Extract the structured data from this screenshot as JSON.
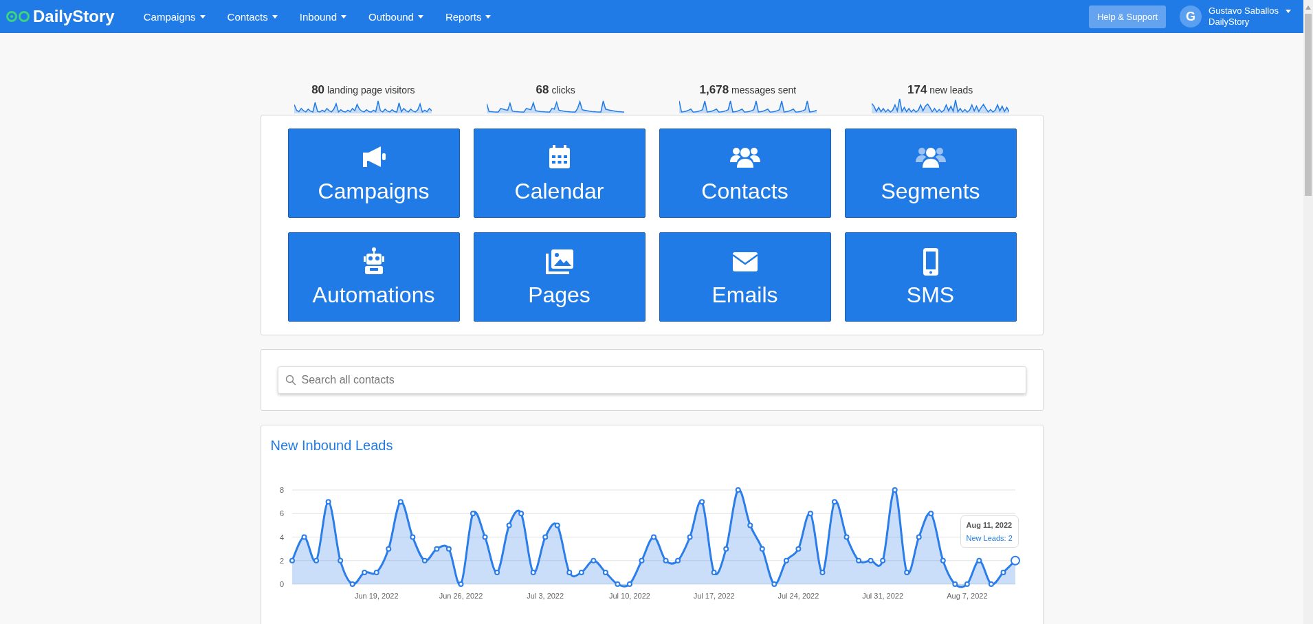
{
  "nav": {
    "logo": "DailyStory",
    "menu": [
      {
        "label": "Campaigns"
      },
      {
        "label": "Contacts"
      },
      {
        "label": "Inbound"
      },
      {
        "label": "Outbound"
      },
      {
        "label": "Reports"
      }
    ],
    "help_button": "Help & Support",
    "user": {
      "initial": "G",
      "name": "Gustavo Saballos",
      "org": "DailyStory"
    }
  },
  "stats": [
    {
      "value": "80",
      "label": "landing page visitors"
    },
    {
      "value": "68",
      "label": "clicks"
    },
    {
      "value": "1,678",
      "label": "messages sent"
    },
    {
      "value": "174",
      "label": "new leads"
    }
  ],
  "tiles": [
    {
      "label": "Campaigns",
      "kind": "megaphone"
    },
    {
      "label": "Calendar",
      "kind": "calendar"
    },
    {
      "label": "Contacts",
      "kind": "users"
    },
    {
      "label": "Segments",
      "kind": "group"
    },
    {
      "label": "Automations",
      "kind": "robot"
    },
    {
      "label": "Pages",
      "kind": "images"
    },
    {
      "label": "Emails",
      "kind": "envelope"
    },
    {
      "label": "SMS",
      "kind": "phone"
    }
  ],
  "search": {
    "placeholder": "Search all contacts"
  },
  "leads_panel": {
    "title": "New Inbound Leads",
    "tooltip": {
      "date": "Aug 11, 2022",
      "text": "New Leads: 2"
    },
    "chart_data": {
      "type": "area",
      "categories": [
        null,
        null,
        null,
        null,
        null,
        null,
        null,
        "Jun 19, 2022",
        null,
        null,
        null,
        null,
        null,
        null,
        "Jun 26, 2022",
        null,
        null,
        null,
        null,
        null,
        null,
        "Jul 3, 2022",
        null,
        null,
        null,
        null,
        null,
        null,
        "Jul 10, 2022",
        null,
        null,
        null,
        null,
        null,
        null,
        "Jul 17, 2022",
        null,
        null,
        null,
        null,
        null,
        null,
        "Jul 24, 2022",
        null,
        null,
        null,
        null,
        null,
        null,
        "Jul 31, 2022",
        null,
        null,
        null,
        null,
        null,
        null,
        "Aug 7, 2022",
        null,
        null,
        null,
        null
      ],
      "series": [
        {
          "color": "#2b7de9",
          "values": [
            2,
            4,
            2,
            7,
            2,
            0,
            1,
            1,
            3,
            7,
            4,
            2,
            3,
            3,
            0,
            6,
            4,
            1,
            5,
            6,
            1,
            4,
            5,
            1,
            1,
            2,
            1,
            0,
            0,
            2,
            4,
            2,
            2,
            4,
            7,
            1,
            3,
            8,
            5,
            3,
            0,
            2,
            3,
            6,
            1,
            7,
            4,
            2,
            2,
            2,
            8,
            1,
            4,
            6,
            2,
            0,
            0,
            2,
            0,
            1,
            2
          ]
        }
      ],
      "ylim": [
        0,
        8
      ],
      "yticks": [
        0,
        2,
        4,
        6,
        8
      ],
      "grid": true
    }
  }
}
